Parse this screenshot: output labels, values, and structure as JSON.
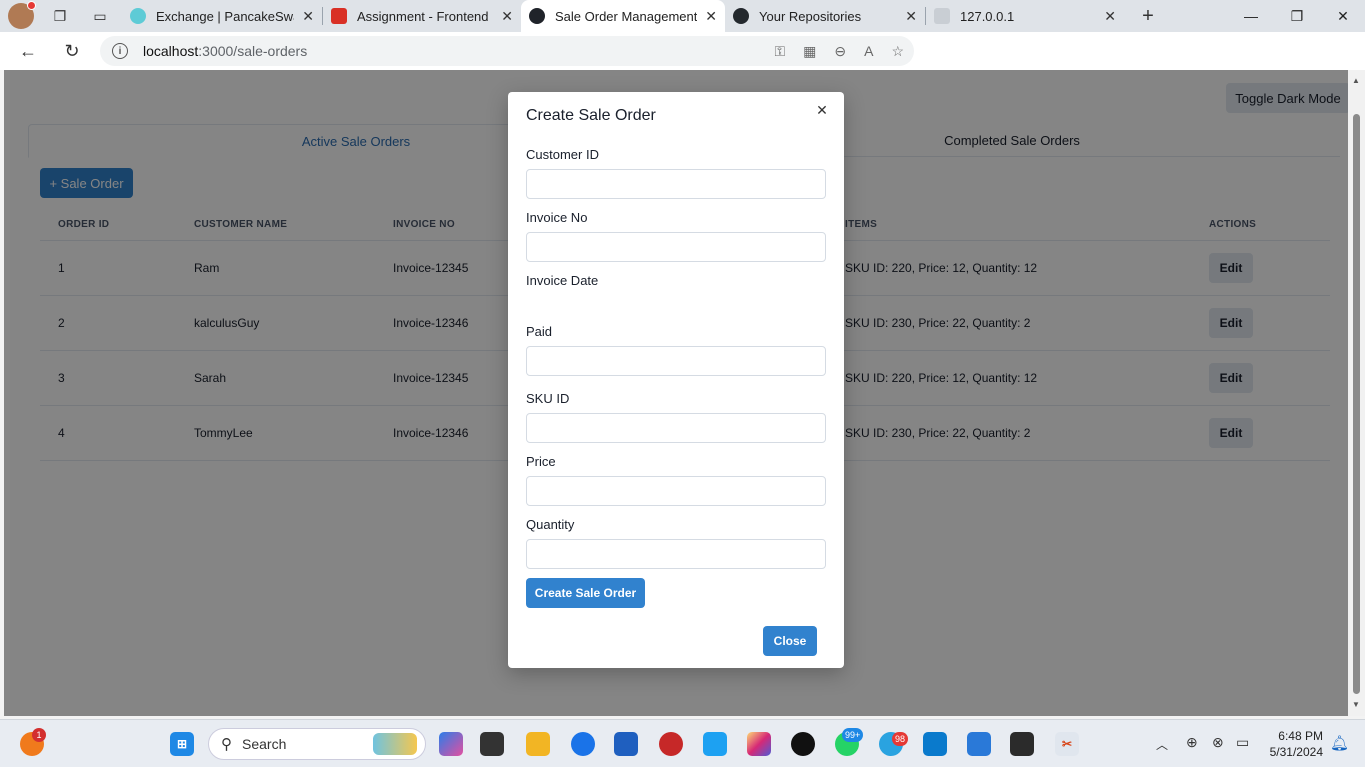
{
  "browser": {
    "tabs": [
      {
        "title": "Exchange | PancakeSwap",
        "active": false
      },
      {
        "title": "Assignment - Frontend De",
        "active": false
      },
      {
        "title": "Sale Order Management S",
        "active": true
      },
      {
        "title": "Your Repositories",
        "active": false
      },
      {
        "title": "127.0.0.1",
        "active": false
      }
    ],
    "url_host": "localhost",
    "url_path": ":3000/sale-orders"
  },
  "page": {
    "toggle_dark_label": "Toggle Dark Mode",
    "tabs": [
      "Active Sale Orders",
      "Completed Sale Orders"
    ],
    "add_button_label": "+ Sale Order",
    "table": {
      "headers": [
        "ORDER ID",
        "CUSTOMER NAME",
        "INVOICE NO",
        "ITEMS",
        "ACTIONS"
      ],
      "rows": [
        {
          "id": "1",
          "customer": "Ram",
          "invoice": "Invoice-12345",
          "items": "SKU ID: 220, Price: 12, Quantity: 12",
          "action": "Edit"
        },
        {
          "id": "2",
          "customer": "kalculusGuy",
          "invoice": "Invoice-12346",
          "items": "SKU ID: 230, Price: 22, Quantity: 2",
          "action": "Edit"
        },
        {
          "id": "3",
          "customer": "Sarah",
          "invoice": "Invoice-12345",
          "items": "SKU ID: 220, Price: 12, Quantity: 12",
          "action": "Edit"
        },
        {
          "id": "4",
          "customer": "TommyLee",
          "invoice": "Invoice-12346",
          "items": "SKU ID: 230, Price: 22, Quantity: 2",
          "action": "Edit"
        }
      ]
    }
  },
  "modal": {
    "title": "Create Sale Order",
    "fields": {
      "customer_id": "Customer ID",
      "invoice_no": "Invoice No",
      "invoice_date": "Invoice Date",
      "paid": "Paid",
      "sku_id": "SKU ID",
      "price": "Price",
      "quantity": "Quantity"
    },
    "submit_label": "Create Sale Order",
    "close_label": "Close"
  },
  "taskbar": {
    "search_label": "Search",
    "notification_count": "1",
    "badge_a": "99+",
    "badge_b": "98",
    "time": "6:48 PM",
    "date": "5/31/2024"
  },
  "colors": {
    "primary": "#3182ce",
    "overlay": "rgba(0,0,0,0.48)"
  }
}
